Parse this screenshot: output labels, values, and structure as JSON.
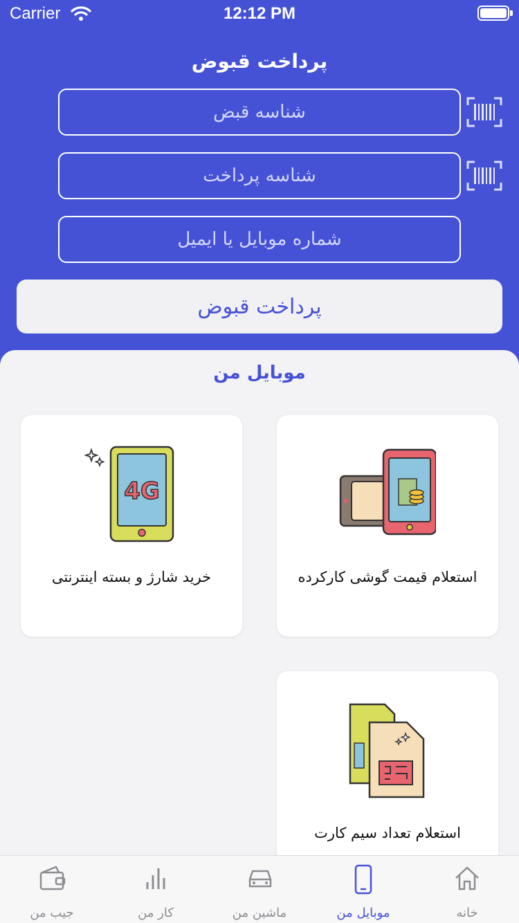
{
  "status_bar": {
    "carrier": "Carrier",
    "time": "12:12 PM"
  },
  "header": {
    "title": "پرداخت قبوض"
  },
  "form": {
    "bill_id_placeholder": "شناسه قبض",
    "payment_id_placeholder": "شناسه پرداخت",
    "contact_placeholder": "شماره موبایل یا ایمیل",
    "submit_label": "پرداخت قبوض"
  },
  "section": {
    "title": "موبایل من",
    "cards": [
      {
        "label": "استعلام قیمت گوشی کارکرده",
        "icon": "used-phone-price-icon"
      },
      {
        "label": "خرید شارژ و بسته اینترنتی",
        "icon": "4g-phone-icon"
      },
      {
        "label": "استعلام تعداد سیم کارت",
        "icon": "sim-card-icon"
      }
    ]
  },
  "icon_text": {
    "badge_4g": "4G"
  },
  "tabbar": {
    "active": "موبایل من",
    "items": [
      {
        "label": "خانه",
        "icon": "home-icon"
      },
      {
        "label": "موبایل من",
        "icon": "mobile-icon"
      },
      {
        "label": "ماشین من",
        "icon": "car-icon"
      },
      {
        "label": "کار من",
        "icon": "chart-icon"
      },
      {
        "label": "جیب من",
        "icon": "wallet-icon"
      }
    ]
  },
  "colors": {
    "primary": "#4652d6",
    "background": "#f3f3f5",
    "inactive_tab": "#8d8d92"
  }
}
